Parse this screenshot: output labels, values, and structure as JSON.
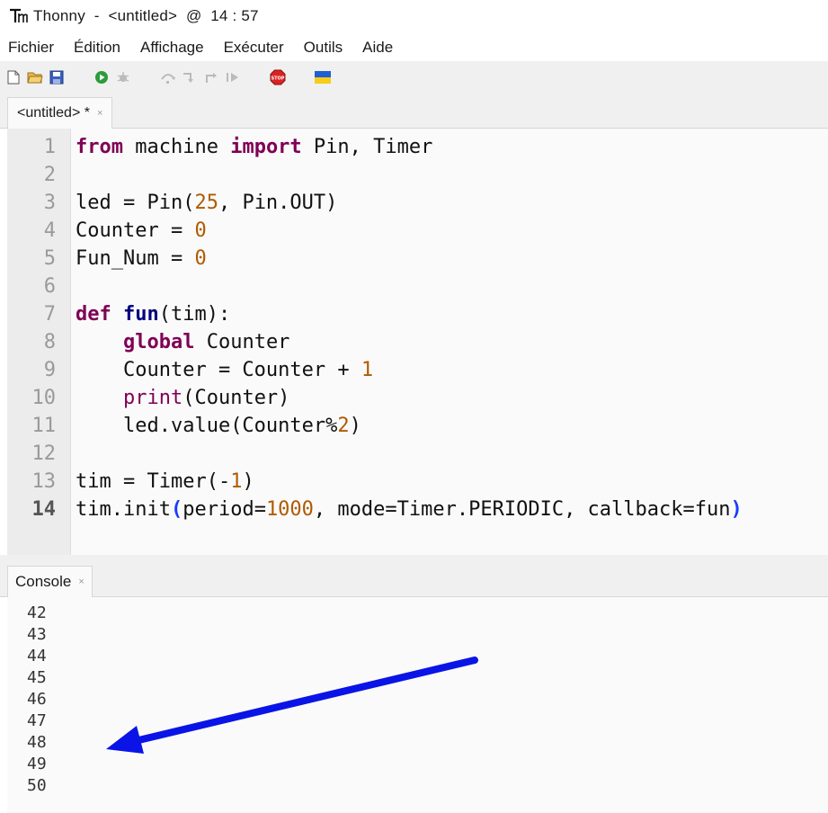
{
  "window": {
    "title": "Thonny  -  <untitled>  @  14 : 57"
  },
  "menu": [
    "Fichier",
    "Édition",
    "Affichage",
    "Exécuter",
    "Outils",
    "Aide"
  ],
  "toolbar": {
    "icons": [
      "new-file-icon",
      "open-file-icon",
      "save-icon",
      "run-icon",
      "debug-icon",
      "step-over-icon",
      "step-into-icon",
      "step-out-icon",
      "resume-icon",
      "stop-icon",
      "ukraine-flag-icon"
    ],
    "stop_label": "STOP"
  },
  "editor": {
    "tab_label": "<untitled> *",
    "close_glyph": "×",
    "current_line": 14,
    "line_numbers": [
      "1",
      "2",
      "3",
      "4",
      "5",
      "6",
      "7",
      "8",
      "9",
      "10",
      "11",
      "12",
      "13",
      "14"
    ]
  },
  "code": {
    "l1": {
      "kw1": "from",
      "t1": " machine ",
      "kw2": "import",
      "t2": " Pin, Timer"
    },
    "l3": {
      "t1": "led = Pin(",
      "n1": "25",
      "t2": ", Pin.OUT)"
    },
    "l4": {
      "t1": "Counter = ",
      "n1": "0"
    },
    "l5": {
      "t1": "Fun_Num = ",
      "n1": "0"
    },
    "l7": {
      "kw1": "def",
      "t1": " ",
      "fn": "fun",
      "t2": "(tim):"
    },
    "l8": {
      "indent": "    ",
      "kw1": "global",
      "t1": " Counter"
    },
    "l9": {
      "indent": "    ",
      "t1": "Counter = Counter + ",
      "n1": "1"
    },
    "l10": {
      "indent": "    ",
      "b1": "print",
      "t1": "(Counter)"
    },
    "l11": {
      "indent": "    ",
      "t1": "led.value(Counter%",
      "n1": "2",
      "t2": ")"
    },
    "l13": {
      "t1": "tim = Timer(-",
      "n1": "1",
      "t2": ")"
    },
    "l14": {
      "t1": "tim.init",
      "p1": "(",
      "t2": "period=",
      "n1": "1000",
      "t3": ", mode=Timer.PERIODIC, callback=fun",
      "p2": ")"
    }
  },
  "console": {
    "tab_label": "Console",
    "close_glyph": "×",
    "output": [
      "42",
      "43",
      "44",
      "45",
      "46",
      "47",
      "48",
      "49",
      "50"
    ]
  },
  "annotation": {
    "arrow_color": "#0a14e6"
  }
}
